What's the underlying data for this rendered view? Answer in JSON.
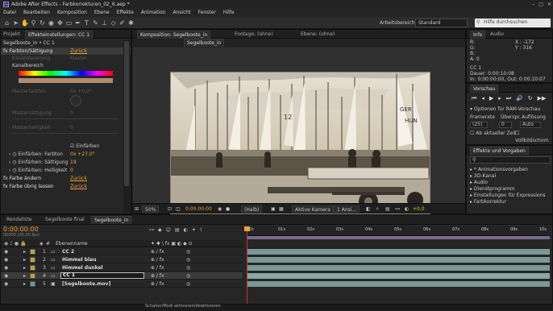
{
  "app": {
    "title": "Adobe After Effects - Farbkorrekturen_02_6.aep *",
    "logo": "Ae",
    "window_controls": [
      "–",
      "□",
      "✕"
    ]
  },
  "menu": [
    "Datei",
    "Bearbeiten",
    "Komposition",
    "Ebene",
    "Effekte",
    "Animation",
    "Ansicht",
    "Fenster",
    "Hilfe"
  ],
  "toolbar": {
    "icons": [
      "home-icon",
      "arrow-tool-icon",
      "hand-tool-icon",
      "zoom-tool-icon",
      "rotate-tool-icon",
      "camera-tool-icon",
      "pan-behind-icon",
      "rectangle-tool-icon",
      "pen-tool-icon",
      "text-tool-icon",
      "brush-tool-icon",
      "stamp-tool-icon",
      "eraser-tool-icon",
      "roto-brush-icon",
      "puppet-tool-icon"
    ],
    "workspace_label": "Arbeitsbereich:",
    "workspace_value": "Standard",
    "search_placeholder": "Hilfe durchsuchen"
  },
  "left_panel": {
    "tabs": [
      "Projekt",
      "Effekteinstellungen: CC 1"
    ],
    "breadcrumb": "Segelboote_in • CC 1",
    "effects": [
      {
        "name": "fx  Farbton/Sättigung",
        "reset": "Zurück"
      },
      {
        "name": "Kanalsteuerung",
        "value": "Master"
      },
      {
        "name": "Kanalbereich",
        "value": ""
      },
      {
        "name": "Masterfarbton",
        "value": "0x +0,0°"
      },
      {
        "name": "Mastersättigung",
        "value": "0"
      },
      {
        "name": "Masterhelligkeit",
        "value": "0"
      },
      {
        "name": "Einfärben",
        "value": "Einfärben"
      },
      {
        "name": "Einfärben: Farbton",
        "value": "0x +27,0°"
      },
      {
        "name": "Einfärben: Sättigung",
        "value": "19"
      },
      {
        "name": "Einfärben: Helligkeit",
        "value": "0"
      },
      {
        "name": "fx  Farbe ändern",
        "reset": "Zurück"
      },
      {
        "name": "fx  Farbe übrig lassen",
        "reset": "Zurück"
      }
    ]
  },
  "viewer": {
    "tabs": [
      "Komposition: Segelboote_in",
      "Footage: (ohne)",
      "Ebene: (ohne)"
    ],
    "subtab": "Segelboote_in",
    "footer": {
      "zoom": "50%",
      "timecode": "0:00:00:00",
      "resolution": "(Halb)",
      "camera": "Aktive Kamera",
      "views": "1 Ansi...",
      "exposure": "+0,0"
    }
  },
  "info_panel": {
    "tabs": [
      "Info",
      "Audio"
    ],
    "R": "R:",
    "G": "G:",
    "B": "B:",
    "A": "A: 0",
    "X": "X : -172",
    "Y": "Y : 316",
    "layer": "CC 1",
    "dauer": "Dauer: 0:00:10:08",
    "inout": "In: 0:00:00:00, Out: 0:00:10:07"
  },
  "preview_panel": {
    "title": "Vorschau",
    "options_label": "Optionen für RAM-Vorschau",
    "col_labels": [
      "Framerate",
      "Überspr.",
      "Auflösung"
    ],
    "framerate": "(25)",
    "skip": "0",
    "resolution": "Auto",
    "from_current": "Ab aktueller Zeit",
    "fullscreen": "Vollbildschirm"
  },
  "effects_panel": {
    "title": "Effekte und Vorgaben",
    "search_placeholder": "",
    "items": [
      "* Animationsvorgaben",
      "3D-Kanal",
      "Audio",
      "Dienstprogramm",
      "Einstellungen für Expressions",
      "Farbkorrektur"
    ]
  },
  "timeline": {
    "tabs": [
      "Rendeliste",
      "Segelboote final",
      "Segelboote_in"
    ],
    "timecode": "0:00:00:00",
    "fps": "00000 (25.00 fps)",
    "column_header": "Ebenenname",
    "ruler_ticks": [
      "0s",
      "01s",
      "02s",
      "03s",
      "04s",
      "05s",
      "06s",
      "07s",
      "08s",
      "09s",
      "10s"
    ],
    "layers": [
      {
        "num": "1",
        "name": "CC 2",
        "selected": false
      },
      {
        "num": "2",
        "name": "Himmel blau",
        "selected": false
      },
      {
        "num": "3",
        "name": "Himmel dunkel",
        "selected": false
      },
      {
        "num": "4",
        "name": "CC 1",
        "selected": true
      },
      {
        "num": "5",
        "name": "[Segelboote.mov]",
        "selected": false
      }
    ],
    "status": "Schalter/Modi aktivieren/deaktivieren"
  },
  "colors": {
    "accent_orange": "#e8a33a",
    "playhead": "#d42b2b",
    "track": "#7a9896",
    "label_yellow": "#e6c645"
  }
}
